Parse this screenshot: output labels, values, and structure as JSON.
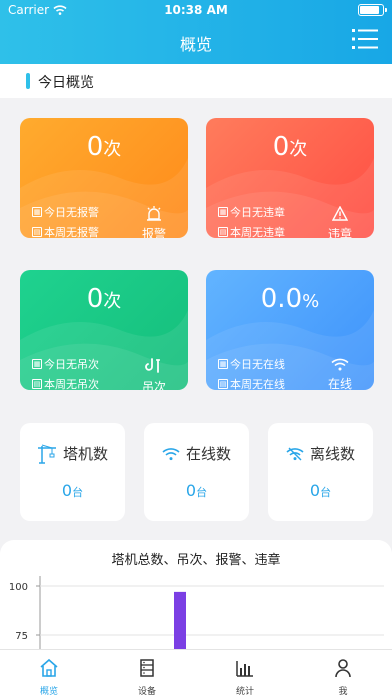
{
  "status_bar": {
    "carrier": "Carrier",
    "time": "10:38 AM"
  },
  "header": {
    "title": "概览"
  },
  "section": {
    "title": "今日概览"
  },
  "cards": {
    "alarm": {
      "count": "0",
      "unit": "次",
      "today": "今日无报警",
      "week": "本周无报警",
      "label": "报警",
      "icon": "alarm-icon"
    },
    "violation": {
      "count": "0",
      "unit": "次",
      "today": "今日无违章",
      "week": "本周无违章",
      "label": "违章",
      "icon": "warning-icon"
    },
    "lift": {
      "count": "0",
      "unit": "次",
      "today": "今日无吊次",
      "week": "本周无吊次",
      "label": "吊次",
      "icon": "hook-icon"
    },
    "online": {
      "count": "0.0",
      "unit": "%",
      "today": "今日无在线",
      "week": "本周无在线",
      "label": "在线",
      "icon": "wifi-icon"
    }
  },
  "stats": [
    {
      "label": "塔机数",
      "value": "0",
      "unit": "台",
      "icon": "tower-crane-icon"
    },
    {
      "label": "在线数",
      "value": "0",
      "unit": "台",
      "icon": "wifi-icon"
    },
    {
      "label": "离线数",
      "value": "0",
      "unit": "台",
      "icon": "wifi-off-icon"
    }
  ],
  "chart_data": {
    "type": "bar",
    "title": "塔机总数、吊次、报警、违章",
    "y_ticks": [
      "100",
      "75"
    ],
    "ylim": [
      0,
      100
    ],
    "values": [
      97
    ],
    "colors": {
      "bar": "#7b3fe4",
      "axis": "#999999"
    }
  },
  "tabbar": [
    {
      "label": "概览",
      "icon": "home-icon",
      "active": true
    },
    {
      "label": "设备",
      "icon": "device-icon",
      "active": false
    },
    {
      "label": "统计",
      "icon": "bar-chart-icon",
      "active": false
    },
    {
      "label": "我",
      "icon": "user-icon",
      "active": false
    }
  ],
  "colors": {
    "accent": "#2aa6e8",
    "header": "#18a7e6"
  }
}
